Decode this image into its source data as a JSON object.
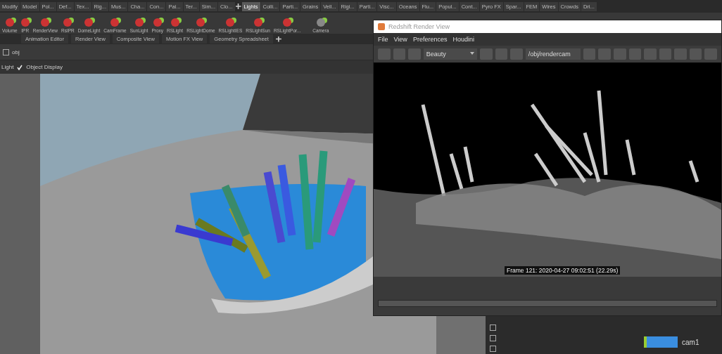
{
  "shelf_tabs": [
    {
      "label": "Modify",
      "selected": false
    },
    {
      "label": "Model",
      "selected": false
    },
    {
      "label": "Pol...",
      "selected": false
    },
    {
      "label": "Def...",
      "selected": false
    },
    {
      "label": "Tex...",
      "selected": false
    },
    {
      "label": "Rig...",
      "selected": false
    },
    {
      "label": "Mus...",
      "selected": false
    },
    {
      "label": "Cha...",
      "selected": false
    },
    {
      "label": "Con...",
      "selected": false
    },
    {
      "label": "Pai...",
      "selected": false
    },
    {
      "label": "Ter...",
      "selected": false
    },
    {
      "label": "Sim...",
      "selected": false
    },
    {
      "label": "Clo...",
      "selected": false
    },
    {
      "label": "Lights",
      "selected": true
    },
    {
      "label": "Colli...",
      "selected": false
    },
    {
      "label": "Parti...",
      "selected": false
    },
    {
      "label": "Grains",
      "selected": false
    },
    {
      "label": "Vell...",
      "selected": false
    },
    {
      "label": "Rigi...",
      "selected": false
    },
    {
      "label": "Parti...",
      "selected": false
    },
    {
      "label": "Visc...",
      "selected": false
    },
    {
      "label": "Oceans",
      "selected": false
    },
    {
      "label": "Flu...",
      "selected": false
    },
    {
      "label": "Popul...",
      "selected": false
    },
    {
      "label": "Cont...",
      "selected": false
    },
    {
      "label": "Pyro FX",
      "selected": false
    },
    {
      "label": "Spar...",
      "selected": false
    },
    {
      "label": "FEM",
      "selected": false
    },
    {
      "label": "Wires",
      "selected": false
    },
    {
      "label": "Crowds",
      "selected": false
    },
    {
      "label": "Dri...",
      "selected": false
    }
  ],
  "shelf_tools": [
    "Volume",
    "IPR",
    "RenderView",
    "RsIPR",
    "DomeLight",
    "CamFrame",
    "SunLight",
    "Proxy",
    "RSLight",
    "RSLightDome",
    "RSLightIES",
    "RSLightSun",
    "RSLightPor..."
  ],
  "camera_tool": "Camera",
  "pane_tabs": [
    {
      "label": "Animation Editor",
      "selected": false
    },
    {
      "label": "Render View",
      "selected": false
    },
    {
      "label": "Composite View",
      "selected": false
    },
    {
      "label": "Motion FX View",
      "selected": false
    },
    {
      "label": "Geometry Spreadsheet",
      "selected": false
    }
  ],
  "path": "obj",
  "viewport_toolbar": {
    "light_label": "Light",
    "object_display": "Object Display",
    "object_display_checked": true
  },
  "render_view": {
    "title": "Redshift Render View",
    "menu": [
      "File",
      "View",
      "Preferences",
      "Houdini"
    ],
    "aov": "Beauty",
    "camera_path": "/obj/rendercam",
    "status": "Frame 121: 2020-04-27 09:02:51 (22.29s)"
  },
  "network": {
    "nodes": [
      {
        "label": "cam1"
      }
    ]
  }
}
